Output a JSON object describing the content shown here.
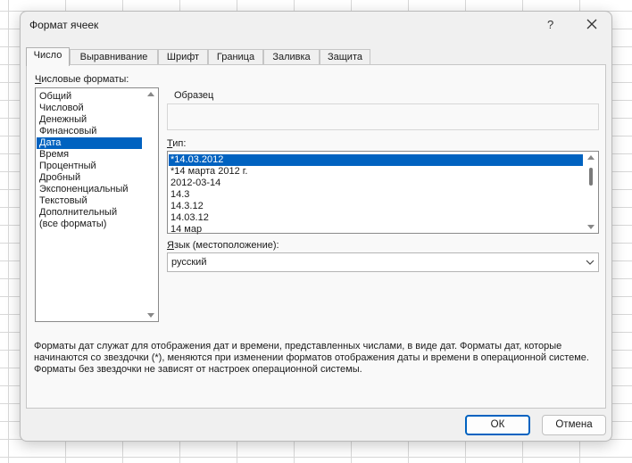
{
  "dialog": {
    "title": "Формат ячеек",
    "help_label": "?"
  },
  "tabs": [
    {
      "label": "Число"
    },
    {
      "label": "Выравнивание"
    },
    {
      "label": "Шрифт"
    },
    {
      "label": "Граница"
    },
    {
      "label": "Заливка"
    },
    {
      "label": "Защита"
    }
  ],
  "categories": {
    "label_hotkey": "Ч",
    "label_rest": "исловые форматы:",
    "items": [
      "Общий",
      "Числовой",
      "Денежный",
      "Финансовый",
      "Дата",
      "Время",
      "Процентный",
      "Дробный",
      "Экспоненциальный",
      "Текстовый",
      "Дополнительный",
      "(все форматы)"
    ],
    "selected": "Дата"
  },
  "sample": {
    "label": "Образец",
    "value": ""
  },
  "type": {
    "label_hotkey": "Т",
    "label_rest": "ип:",
    "items": [
      "*14.03.2012",
      "*14 марта 2012 г.",
      "2012-03-14",
      "14.3",
      "14.3.12",
      "14.03.12",
      "14 мар"
    ],
    "selected": "*14.03.2012"
  },
  "language": {
    "label_hotkey": "Я",
    "label_rest": "зык (местоположение):",
    "value": "русский"
  },
  "description": "Форматы дат служат для отображения дат и времени, представленных числами, в виде дат. Форматы дат, которые начинаются со звездочки (*), меняются при изменении форматов отображения даты и времени в операционной системе. Форматы без звездочки не зависят от настроек операционной системы.",
  "buttons": {
    "ok": "ОК",
    "cancel": "Отмена"
  },
  "colors": {
    "selection": "#0062c0",
    "dialog_bg": "#f0f0f0",
    "panel_bg": "#f9f9f9"
  }
}
